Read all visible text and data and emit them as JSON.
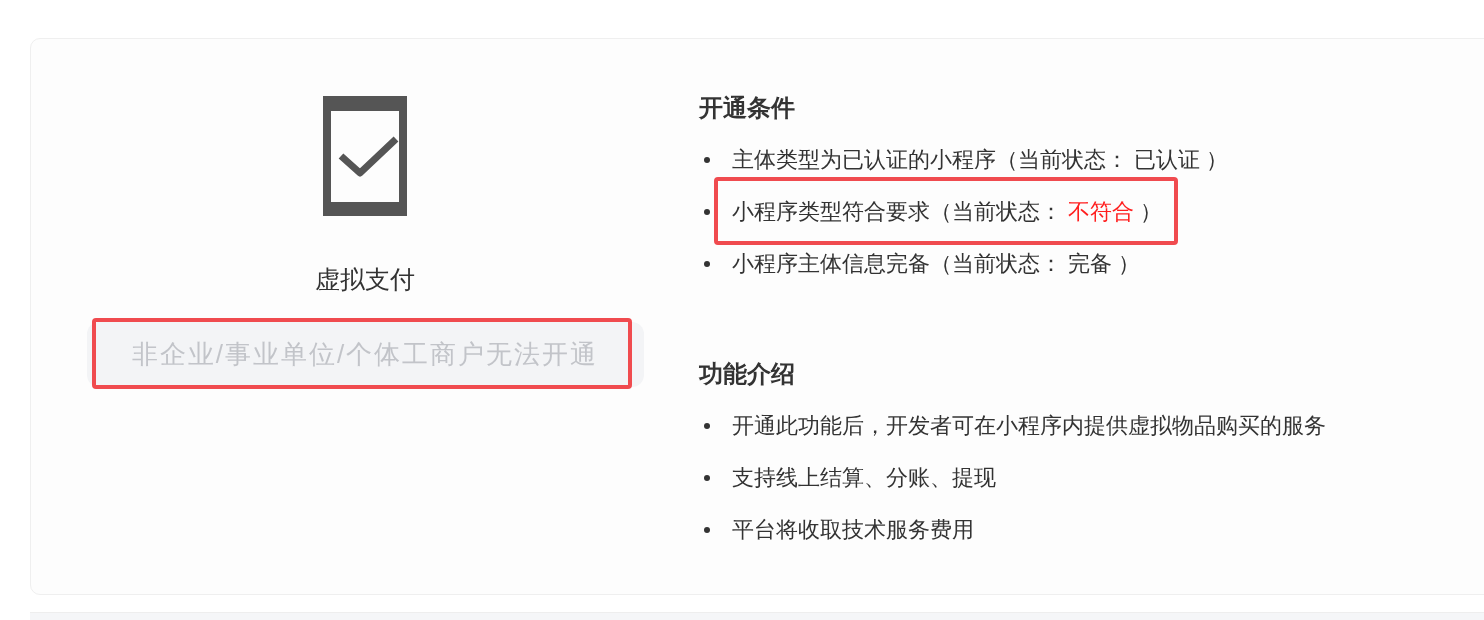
{
  "feature": {
    "title": "虚拟支付",
    "button": {
      "label": "非企业/事业单位/个体工商户无法开通",
      "disabled": true,
      "highlighted": true
    }
  },
  "conditions": {
    "heading": "开通条件",
    "items": [
      {
        "text": "主体类型为已认证的小程序（当前状态：",
        "status": "已认证",
        "suffix": "）",
        "met": true,
        "highlighted": false
      },
      {
        "text": "小程序类型符合要求（当前状态：",
        "status": "不符合",
        "suffix": "）",
        "met": false,
        "highlighted": true
      },
      {
        "text": "小程序主体信息完备（当前状态：",
        "status": "完备",
        "suffix": "）",
        "met": true,
        "highlighted": false
      }
    ]
  },
  "introduction": {
    "heading": "功能介绍",
    "items": [
      "开通此功能后，开发者可在小程序内提供虚拟物品购买的服务",
      "支持线上结算、分账、提现",
      "平台将收取技术服务费用"
    ]
  }
}
